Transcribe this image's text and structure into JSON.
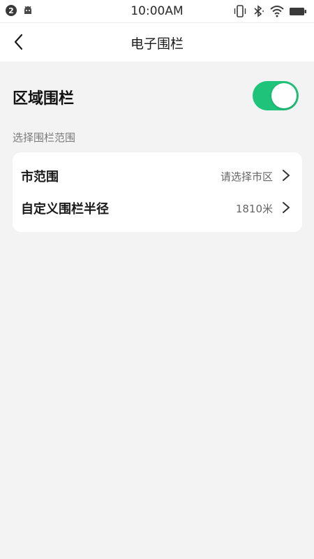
{
  "status_bar": {
    "notification_count": "2",
    "time": "10:00AM",
    "icons": [
      "android-icon",
      "vibrate-icon",
      "bluetooth-icon",
      "wifi-icon",
      "battery-icon"
    ]
  },
  "nav": {
    "title": "电子围栏",
    "back_icon": "chevron-left-icon"
  },
  "region": {
    "title": "区域围栏",
    "toggle_on": true,
    "toggle_color": "#1fc37a"
  },
  "section": {
    "label": "选择围栏范围"
  },
  "rows": [
    {
      "label": "市范围",
      "value": "请选择市区",
      "icon": "chevron-right-icon"
    },
    {
      "label": "自定义围栏半径",
      "value": "1810米",
      "icon": "chevron-right-icon"
    }
  ]
}
